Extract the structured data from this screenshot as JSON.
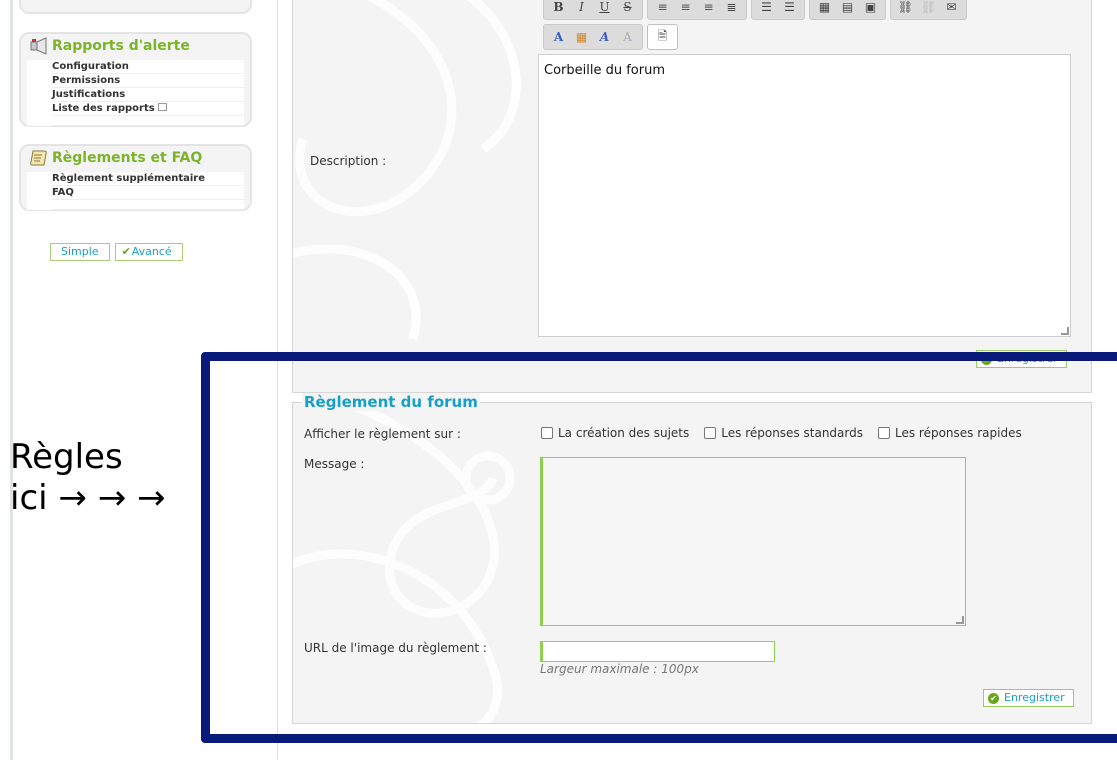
{
  "sidebar": {
    "alert_title": "Rapports d'alerte",
    "alert_items": [
      "Configuration",
      "Permissions",
      "Justifications",
      "Liste des rapports"
    ],
    "rules_title": "Règlements et FAQ",
    "rules_items": [
      "Règlement supplémentaire",
      "FAQ"
    ],
    "mode_simple": "Simple",
    "mode_advanced": "Avancé"
  },
  "editor": {
    "toolbar_row1": [
      "B",
      "I",
      "U",
      "S"
    ],
    "description_label": "Description :",
    "description_value": "Corbeille du forum",
    "save_label": "Enregistrer"
  },
  "rules_section": {
    "legend": "Règlement du forum",
    "show_label": "Afficher le règlement sur :",
    "options": [
      "La création des sujets",
      "Les réponses standards",
      "Les réponses rapides"
    ],
    "message_label": "Message :",
    "url_label": "URL de l'image du règlement :",
    "url_hint": "Largeur maximale : 100px",
    "save_label": "Enregistrer"
  },
  "annotation": {
    "text": "Règles\nici → → →",
    "highlight_color": "#081a7a"
  },
  "colors": {
    "accent_green": "#7bb42a",
    "link_blue": "#1a9fc4"
  }
}
